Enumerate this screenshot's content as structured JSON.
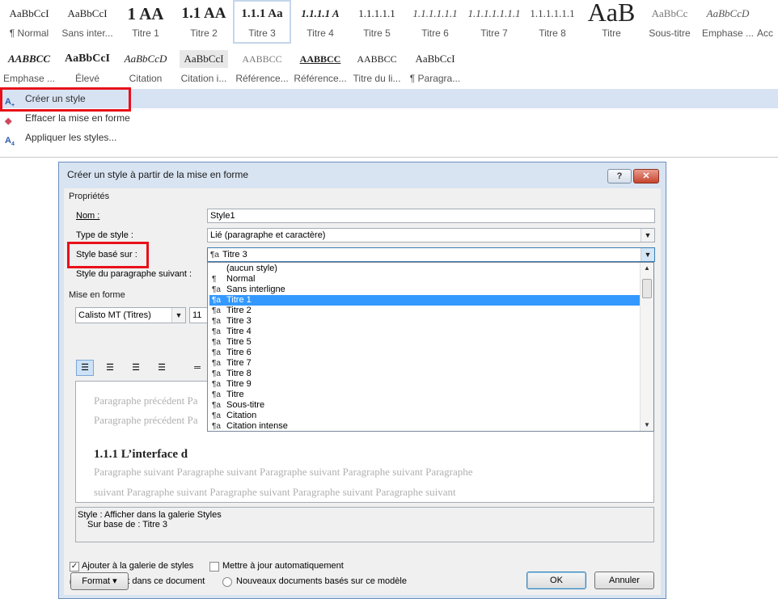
{
  "gallery_row1": [
    {
      "sample": "AaBbCcI",
      "name": "¶ Normal"
    },
    {
      "sample": "AaBbCcI",
      "name": "Sans inter..."
    },
    {
      "sample": "1 AA",
      "name": "Titre 1"
    },
    {
      "sample": "1.1 AA",
      "name": "Titre 2"
    },
    {
      "sample": "1.1.1 Aa",
      "name": "Titre 3"
    },
    {
      "sample": "1.1.1.1 A",
      "name": "Titre 4"
    },
    {
      "sample": "1.1.1.1.1",
      "name": "Titre 5"
    },
    {
      "sample": "1.1.1.1.1.1",
      "name": "Titre 6"
    },
    {
      "sample": "1.1.1.1.1.1.1",
      "name": "Titre 7"
    },
    {
      "sample": "1.1.1.1.1.1",
      "name": "Titre 8"
    },
    {
      "sample": "AaB",
      "name": "Titre"
    },
    {
      "sample": "AaBbCc",
      "name": "Sous-titre"
    },
    {
      "sample": "AaBbCcD",
      "name": "Emphase ..."
    },
    {
      "sample": "",
      "name": "Acc"
    }
  ],
  "gallery_row2": [
    {
      "sample": "AABBCC",
      "name": "Emphase ..."
    },
    {
      "sample": "AaBbCcI",
      "name": "Élevé"
    },
    {
      "sample": "AaBbCcD",
      "name": "Citation"
    },
    {
      "sample": "AaBbCcI",
      "name": "Citation i..."
    },
    {
      "sample": "AABBCC",
      "name": "Référence..."
    },
    {
      "sample": "AABBCC",
      "name": "Référence..."
    },
    {
      "sample": "AABBCC",
      "name": "Titre du li..."
    },
    {
      "sample": "AaBbCcI",
      "name": "¶ Paragra..."
    }
  ],
  "commands": {
    "create": "Créer un style",
    "clear": "Effacer la mise en forme",
    "apply": "Appliquer les styles..."
  },
  "dialog": {
    "title": "Créer un style à partir de la mise en forme",
    "help": "?",
    "close": "✕",
    "properties_head": "Propriétés",
    "name_label": "Nom :",
    "name_value": "Style1",
    "type_label": "Type de style :",
    "type_value": "Lié (paragraphe et caractère)",
    "based_label": "Style basé sur :",
    "based_value": "Titre 3",
    "next_label": "Style du paragraphe suivant :",
    "format_head": "Mise en forme",
    "font_value": "Calisto MT (Titres)",
    "size_value": "11",
    "preview_prev1": "Paragraphe précédent Pa",
    "preview_prev2": "Paragraphe précédent Pa",
    "preview_heading": "1.1.1    L’interface d",
    "preview_next1": "Paragraphe suivant Paragraphe suivant Paragraphe suivant Paragraphe suivant Paragraphe",
    "preview_next2": "suivant Paragraphe suivant Paragraphe suivant Paragraphe suivant Paragraphe suivant",
    "desc_line1": "Style : Afficher dans la galerie Styles",
    "desc_line2": "Sur base de : Titre 3",
    "add_gallery": "Ajouter à la galerie de styles",
    "auto_update": "Mettre à jour automatiquement",
    "only_doc": "Uniquement dans ce document",
    "new_docs": "Nouveaux documents basés sur ce modèle",
    "format_btn": "Format ▾",
    "ok": "OK",
    "cancel": "Annuler"
  },
  "state": {
    "add_gallery_checked": true,
    "auto_update_checked": false,
    "scope": "only_doc",
    "list_selected": "Titre 1"
  },
  "dropdown_items": [
    {
      "glyph": "",
      "label": "(aucun style)"
    },
    {
      "glyph": "¶",
      "label": "Normal"
    },
    {
      "glyph": "¶a",
      "label": "Sans interligne"
    },
    {
      "glyph": "¶a",
      "label": "Titre 1"
    },
    {
      "glyph": "¶a",
      "label": "Titre 2"
    },
    {
      "glyph": "¶a",
      "label": "Titre 3"
    },
    {
      "glyph": "¶a",
      "label": "Titre 4"
    },
    {
      "glyph": "¶a",
      "label": "Titre 5"
    },
    {
      "glyph": "¶a",
      "label": "Titre 6"
    },
    {
      "glyph": "¶a",
      "label": "Titre 7"
    },
    {
      "glyph": "¶a",
      "label": "Titre 8"
    },
    {
      "glyph": "¶a",
      "label": "Titre 9"
    },
    {
      "glyph": "¶a",
      "label": "Titre"
    },
    {
      "glyph": "¶a",
      "label": "Sous-titre"
    },
    {
      "glyph": "¶a",
      "label": "Citation"
    },
    {
      "glyph": "¶a",
      "label": "Citation intense"
    }
  ],
  "colors": {
    "highlight_box": "#e8101a",
    "list_selection": "#3399ff",
    "command_hover": "#d7e3f3",
    "dialog_frame": "#d9e4f2"
  },
  "icons": {
    "create": "create-style-icon",
    "clear": "eraser-icon",
    "apply": "apply-styles-icon"
  }
}
